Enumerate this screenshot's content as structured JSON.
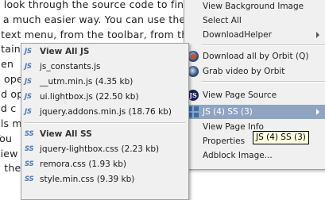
{
  "article": {
    "lines": [
      "y look through the source code to fin",
      "s a much easier way. You can use the",
      "ntext menu, from the toolbar, from th",
      "ntain",
      "hen",
      "o ope",
      "nd op",
      "ed c",
      "ols m",
      "You",
      "view",
      "n the"
    ]
  },
  "context_menu": {
    "items": [
      {
        "label": "View Background Image"
      },
      {
        "label": "Select All"
      },
      {
        "label": "DownloadHelper"
      },
      {
        "label": "Download all by Orbit (Q)"
      },
      {
        "label": "Grab video by Orbit"
      },
      {
        "label": "View Page Source"
      },
      {
        "label": "JS (4) SS (3)"
      },
      {
        "label": "View Page Info"
      },
      {
        "label": "Properties"
      },
      {
        "label": "Adblock Image..."
      }
    ]
  },
  "submenu": {
    "js_header": "View All JS",
    "js_files": [
      "js_constants.js",
      "__utm.min.js (4.35 kb)",
      "ui.lightbox.js (22.50 kb)",
      "jquery.addons.min.js (18.76 kb)"
    ],
    "ss_header": "View All SS",
    "ss_files": [
      "jquery-lightbox.css (2.23 kb)",
      "remora.css (1.93 kb)",
      "style.min.css (9.39 kb)"
    ],
    "js_tag": "JS",
    "ss_tag": "SS"
  },
  "tooltip": {
    "text": "JS (4) SS (3)"
  }
}
